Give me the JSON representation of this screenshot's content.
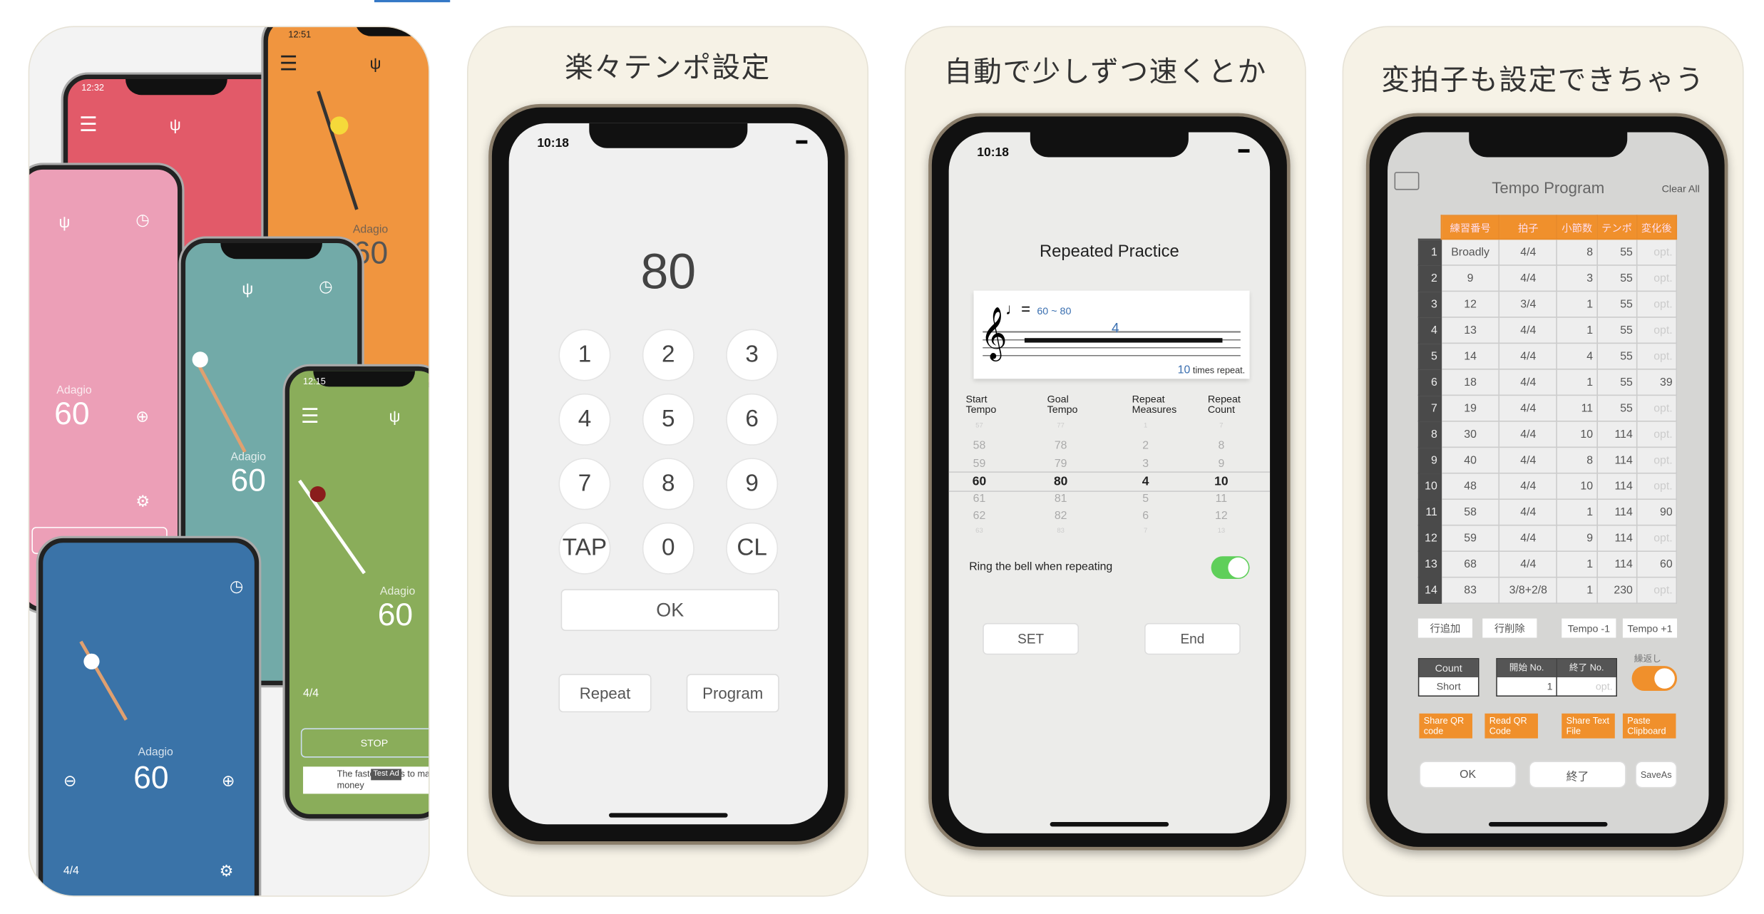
{
  "panel1": {
    "red_time": "12:32",
    "orange_time": "12:51",
    "green_time": "12:15",
    "tempo_name": "Adagio",
    "tempo_value": "60",
    "stop_label": "STOP",
    "time_sig": "4/4",
    "ad_text": "The fastest ways to make money",
    "ad_badge": "Test Ad",
    "colors": {
      "red": "#e25a69",
      "orange": "#f0953f",
      "pink": "#ec9fb7",
      "teal": "#72aaa8",
      "green": "#8aad5a",
      "blue": "#3a73a8"
    }
  },
  "panel2": {
    "title": "楽々テンポ設定",
    "time": "10:18",
    "display": "80",
    "keys": [
      "1",
      "2",
      "3",
      "4",
      "5",
      "6",
      "7",
      "8",
      "9",
      "TAP",
      "0",
      "CL"
    ],
    "ok": "OK",
    "repeat": "Repeat",
    "program": "Program"
  },
  "panel3": {
    "title": "自動で少しずつ速くとか",
    "time": "10:18",
    "heading": "Repeated Practice",
    "staff_tempo": "60 ~ 80",
    "staff_measures": "4",
    "repeat_count": "10",
    "repeat_suffix": "times repeat.",
    "columns": [
      {
        "label1": "Start",
        "label2": "Tempo",
        "values": [
          "57",
          "58",
          "59",
          "60",
          "61",
          "62",
          "63"
        ]
      },
      {
        "label1": "Goal",
        "label2": "Tempo",
        "values": [
          "77",
          "78",
          "79",
          "80",
          "81",
          "82",
          "83"
        ]
      },
      {
        "label1": "Repeat",
        "label2": "Measures",
        "values": [
          "1",
          "2",
          "3",
          "4",
          "5",
          "6",
          "7"
        ]
      },
      {
        "label1": "Repeat",
        "label2": "Count",
        "values": [
          "7",
          "8",
          "9",
          "10",
          "11",
          "12",
          "13"
        ]
      }
    ],
    "bell_label": "Ring the bell when repeating",
    "bell_on": true,
    "set": "SET",
    "end": "End"
  },
  "panel4": {
    "title": "変拍子も設定できちゃう",
    "heading": "Tempo Program",
    "clear_all": "Clear All",
    "headers": [
      "練習番号",
      "拍子",
      "小節数",
      "テンポ",
      "変化後"
    ],
    "rows": [
      [
        "1",
        "Broadly",
        "4/4",
        "8",
        "55",
        "opt."
      ],
      [
        "2",
        "9",
        "4/4",
        "3",
        "55",
        "opt."
      ],
      [
        "3",
        "12",
        "3/4",
        "1",
        "55",
        "opt."
      ],
      [
        "4",
        "13",
        "4/4",
        "1",
        "55",
        "opt."
      ],
      [
        "5",
        "14",
        "4/4",
        "4",
        "55",
        "opt."
      ],
      [
        "6",
        "18",
        "4/4",
        "1",
        "55",
        "39"
      ],
      [
        "7",
        "19",
        "4/4",
        "11",
        "55",
        "opt."
      ],
      [
        "8",
        "30",
        "4/4",
        "10",
        "114",
        "opt."
      ],
      [
        "9",
        "40",
        "4/4",
        "8",
        "114",
        "opt."
      ],
      [
        "10",
        "48",
        "4/4",
        "10",
        "114",
        "opt."
      ],
      [
        "11",
        "58",
        "4/4",
        "1",
        "114",
        "90"
      ],
      [
        "12",
        "59",
        "4/4",
        "9",
        "114",
        "opt."
      ],
      [
        "13",
        "68",
        "4/4",
        "1",
        "114",
        "60"
      ],
      [
        "14",
        "83",
        "3/8+2/8",
        "1",
        "230",
        "opt."
      ]
    ],
    "add_row": "行追加",
    "delete_row": "行削除",
    "tempo_minus": "Tempo -1",
    "tempo_plus": "Tempo +1",
    "count_label": "Count",
    "count_value": "Short",
    "start_label": "開始 No.",
    "start_value": "1",
    "end_label": "終了 No.",
    "end_placeholder": "opt.",
    "repeat_label": "繰返し",
    "repeat_on": true,
    "share_qr": "Share QR code",
    "read_qr": "Read QR Code",
    "share_text": "Share Text File",
    "paste": "Paste Clipboard",
    "ok": "OK",
    "finish": "終了",
    "save_as": "SaveAs",
    "accent": "#f0902c"
  }
}
